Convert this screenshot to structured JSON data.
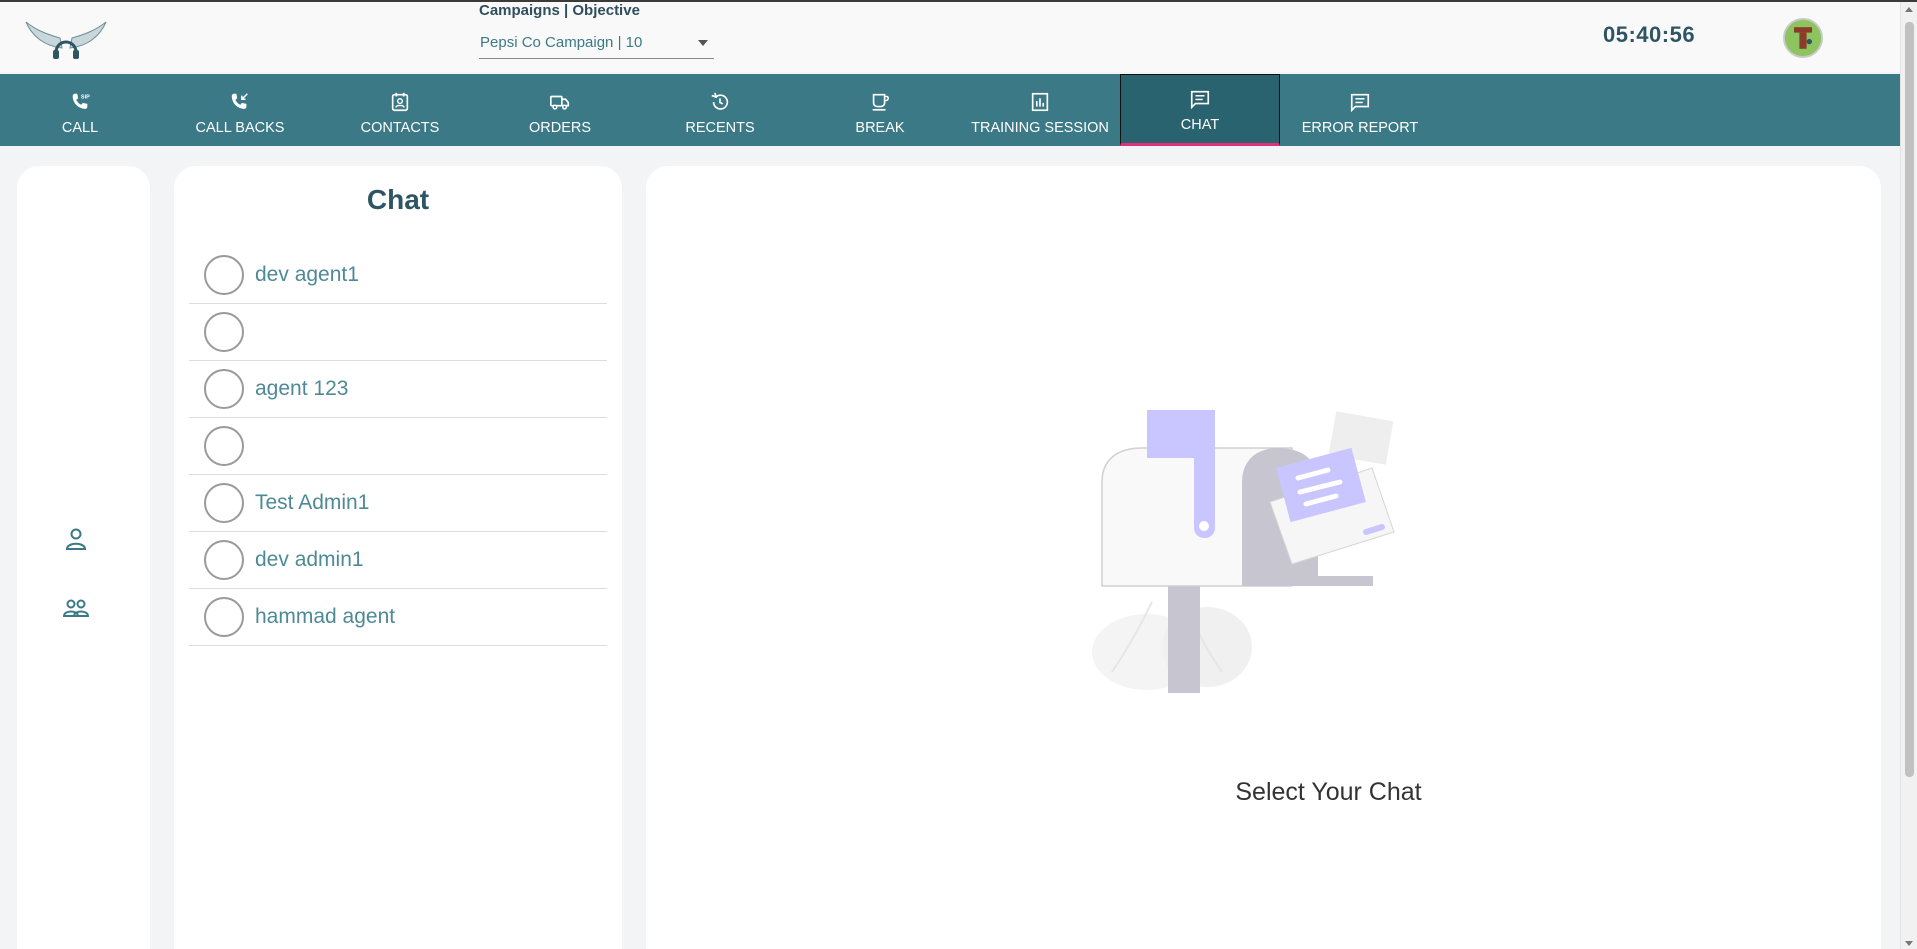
{
  "header": {
    "campaign_label": "Campaigns | Objective",
    "campaign_selected": "Pepsi Co Campaign | 10",
    "clock": "05:40:56",
    "logo_icon": "winged-headset-logo",
    "avatar_icon": "user-avatar"
  },
  "nav": {
    "items": [
      {
        "label": "CALL",
        "icon": "sip-phone-icon"
      },
      {
        "label": "CALL BACKS",
        "icon": "callback-phone-icon"
      },
      {
        "label": "CONTACTS",
        "icon": "contact-card-icon"
      },
      {
        "label": "ORDERS",
        "icon": "truck-icon"
      },
      {
        "label": "RECENTS",
        "icon": "history-icon"
      },
      {
        "label": "BREAK",
        "icon": "coffee-cup-icon"
      },
      {
        "label": "TRAINING SESSION",
        "icon": "bar-chart-icon"
      },
      {
        "label": "CHAT",
        "icon": "chat-bubble-icon"
      },
      {
        "label": "ERROR REPORT",
        "icon": "report-bubble-icon"
      }
    ],
    "active": "CHAT",
    "bar_color": "#3b7987",
    "active_underline_color": "#e0317a"
  },
  "rail": {
    "icons": [
      "single-user-icon",
      "group-users-icon"
    ]
  },
  "chat": {
    "title": "Chat",
    "contacts": [
      {
        "name": "dev agent1"
      },
      {
        "name": ""
      },
      {
        "name": "agent 123"
      },
      {
        "name": ""
      },
      {
        "name": "Test Admin1"
      },
      {
        "name": "dev admin1"
      },
      {
        "name": "hammad agent"
      }
    ]
  },
  "main": {
    "empty_state_text": "Select Your Chat",
    "illustration": "mailbox-illustration"
  }
}
